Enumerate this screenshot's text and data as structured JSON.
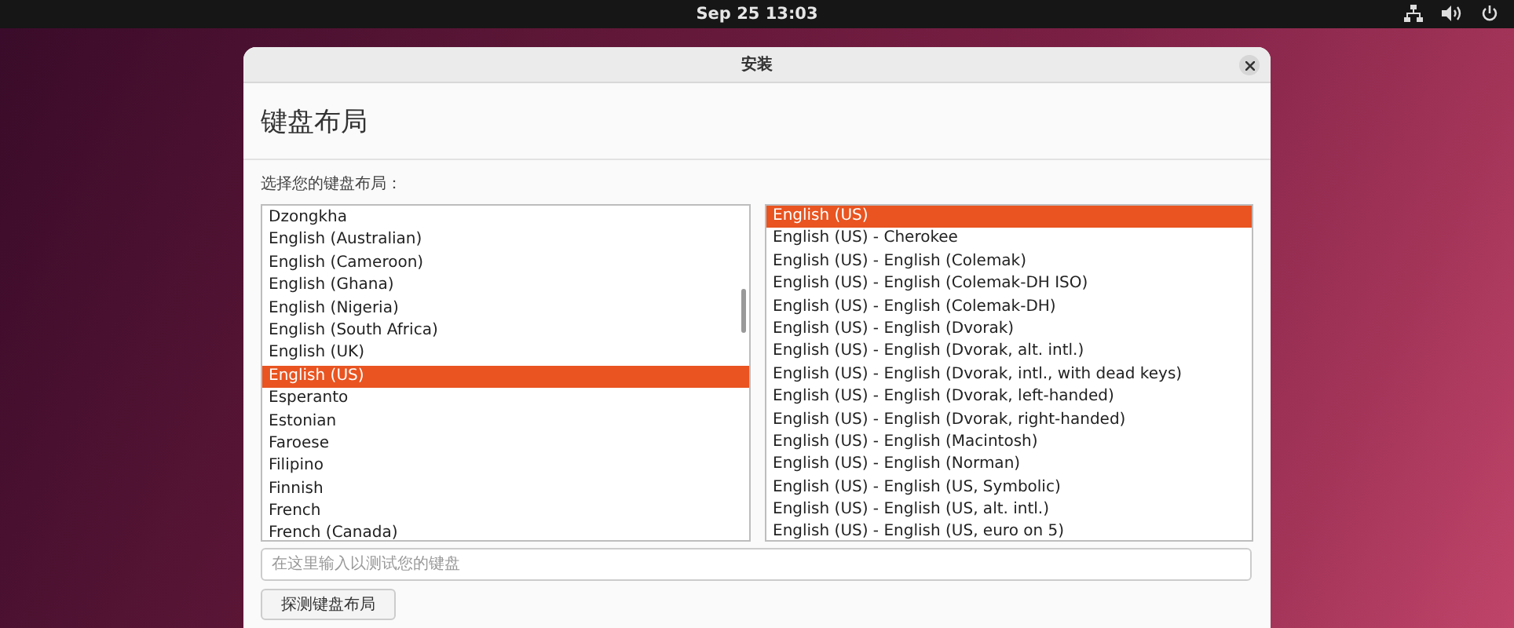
{
  "top_bar": {
    "clock": "Sep 25  13:03"
  },
  "window": {
    "title": "安装",
    "heading": "键盘布局"
  },
  "prompt": "选择您的键盘布局：",
  "layouts": [
    {
      "label": "Dzongkha",
      "selected": false
    },
    {
      "label": "English (Australian)",
      "selected": false
    },
    {
      "label": "English (Cameroon)",
      "selected": false
    },
    {
      "label": "English (Ghana)",
      "selected": false
    },
    {
      "label": "English (Nigeria)",
      "selected": false
    },
    {
      "label": "English (South Africa)",
      "selected": false
    },
    {
      "label": "English (UK)",
      "selected": false
    },
    {
      "label": "English (US)",
      "selected": true
    },
    {
      "label": "Esperanto",
      "selected": false
    },
    {
      "label": "Estonian",
      "selected": false
    },
    {
      "label": "Faroese",
      "selected": false
    },
    {
      "label": "Filipino",
      "selected": false
    },
    {
      "label": "Finnish",
      "selected": false
    },
    {
      "label": "French",
      "selected": false
    },
    {
      "label": "French (Canada)",
      "selected": false
    }
  ],
  "variants": [
    {
      "label": "English (US)",
      "selected": true
    },
    {
      "label": "English (US) - Cherokee",
      "selected": false
    },
    {
      "label": "English (US) - English (Colemak)",
      "selected": false
    },
    {
      "label": "English (US) - English (Colemak-DH ISO)",
      "selected": false
    },
    {
      "label": "English (US) - English (Colemak-DH)",
      "selected": false
    },
    {
      "label": "English (US) - English (Dvorak)",
      "selected": false
    },
    {
      "label": "English (US) - English (Dvorak, alt. intl.)",
      "selected": false
    },
    {
      "label": "English (US) - English (Dvorak, intl., with dead keys)",
      "selected": false
    },
    {
      "label": "English (US) - English (Dvorak, left-handed)",
      "selected": false
    },
    {
      "label": "English (US) - English (Dvorak, right-handed)",
      "selected": false
    },
    {
      "label": "English (US) - English (Macintosh)",
      "selected": false
    },
    {
      "label": "English (US) - English (Norman)",
      "selected": false
    },
    {
      "label": "English (US) - English (US, Symbolic)",
      "selected": false
    },
    {
      "label": "English (US) - English (US, alt. intl.)",
      "selected": false
    },
    {
      "label": "English (US) - English (US, euro on 5)",
      "selected": false
    }
  ],
  "test_field": {
    "placeholder": "在这里输入以测试您的键盘"
  },
  "buttons": [
    "探测键盘布局"
  ]
}
